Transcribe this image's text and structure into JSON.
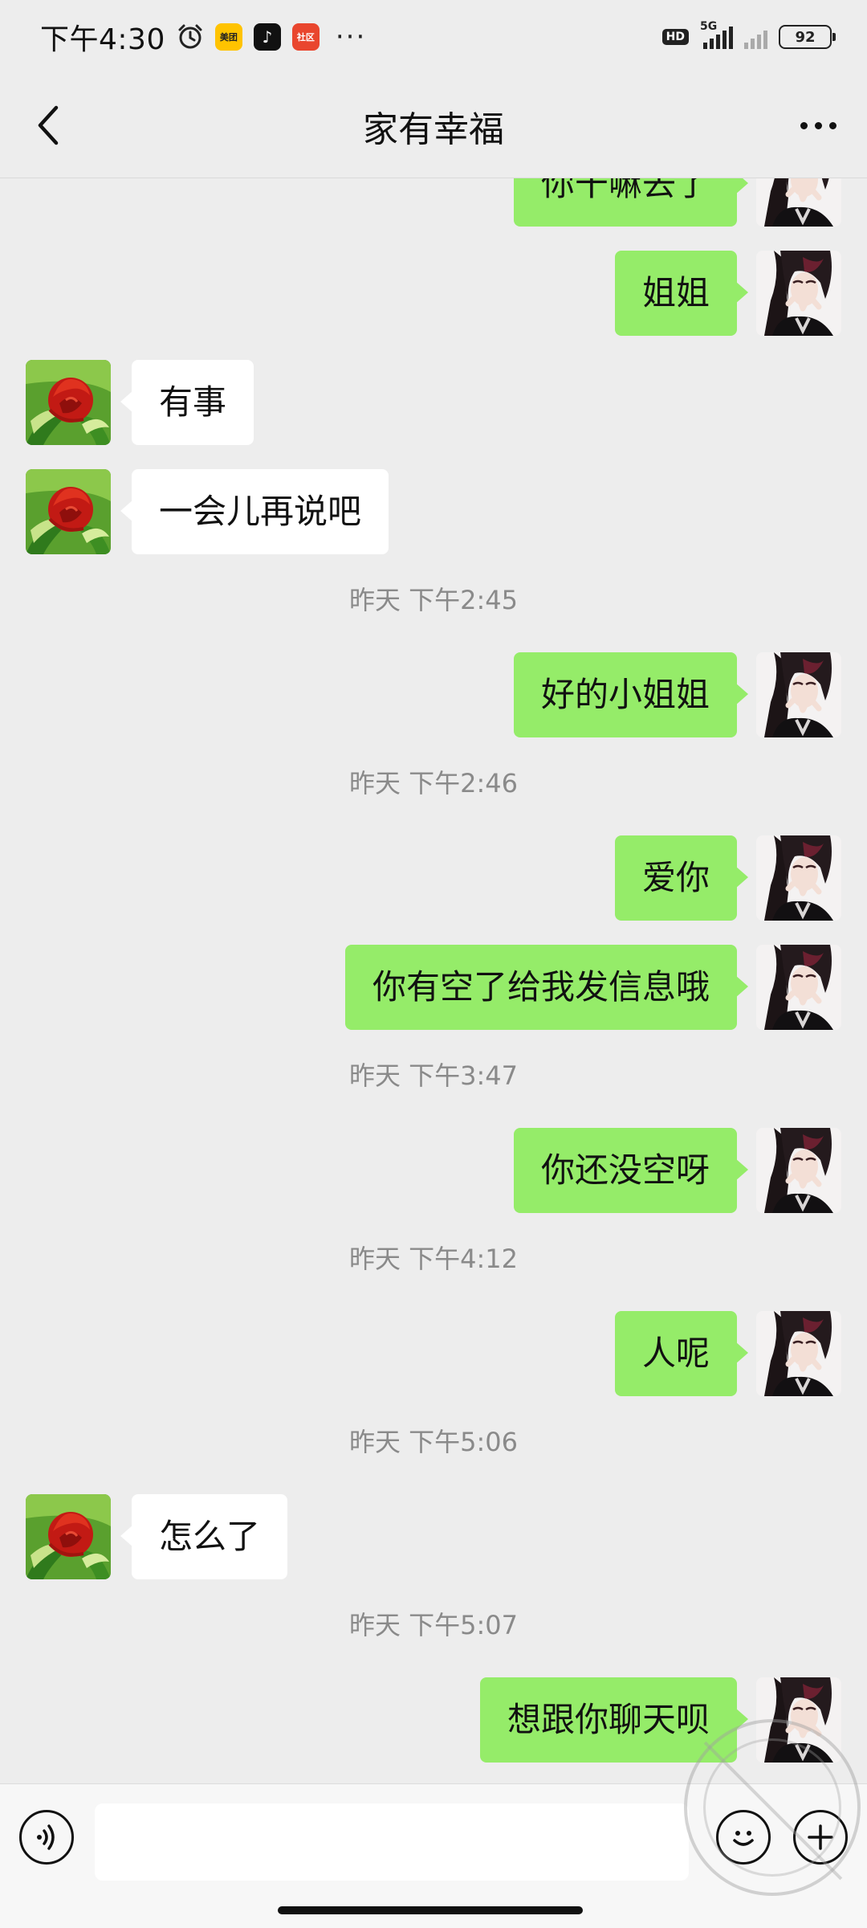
{
  "status_bar": {
    "time": "下午4:30",
    "icons": [
      "alarm-icon",
      "meituan-app-icon",
      "tiktok-app-icon",
      "third-app-icon"
    ],
    "more": "···",
    "hd": "HD",
    "network": "5G",
    "battery": "92"
  },
  "nav": {
    "title": "家有幸福"
  },
  "messages": [
    {
      "type": "msg",
      "sender": "me",
      "text": "你干嘛去了"
    },
    {
      "type": "msg",
      "sender": "me",
      "text": "姐姐"
    },
    {
      "type": "msg",
      "sender": "them",
      "text": "有事"
    },
    {
      "type": "msg",
      "sender": "them",
      "text": "一会儿再说吧"
    },
    {
      "type": "time",
      "text": "昨天 下午2:45"
    },
    {
      "type": "msg",
      "sender": "me",
      "text": "好的小姐姐"
    },
    {
      "type": "time",
      "text": "昨天 下午2:46"
    },
    {
      "type": "msg",
      "sender": "me",
      "text": "爱你"
    },
    {
      "type": "msg",
      "sender": "me",
      "text": "你有空了给我发信息哦"
    },
    {
      "type": "time",
      "text": "昨天 下午3:47"
    },
    {
      "type": "msg",
      "sender": "me",
      "text": "你还没空呀"
    },
    {
      "type": "time",
      "text": "昨天 下午4:12"
    },
    {
      "type": "msg",
      "sender": "me",
      "text": "人呢"
    },
    {
      "type": "time",
      "text": "昨天 下午5:06"
    },
    {
      "type": "msg",
      "sender": "them",
      "text": "怎么了"
    },
    {
      "type": "time",
      "text": "昨天 下午5:07"
    },
    {
      "type": "msg",
      "sender": "me",
      "text": "想跟你聊天呗"
    }
  ],
  "input": {
    "placeholder": ""
  },
  "colors": {
    "me_bubble": "#95ec69",
    "them_bubble": "#ffffff",
    "background": "#ededed"
  }
}
